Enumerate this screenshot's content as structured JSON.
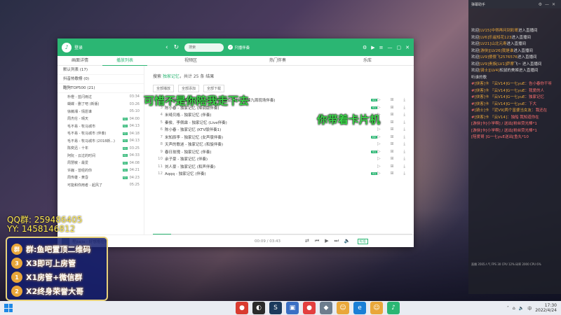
{
  "window": {
    "login": "登录",
    "search_placeholder": "搜索",
    "listen_label": "只播伴奏",
    "tabs": [
      "画面详情",
      "播放列表",
      "视频区",
      "热门伴奏",
      "乐库"
    ],
    "active_tab": 1
  },
  "sidebar": {
    "groups": [
      "默认列表 (17)",
      "抖音热歌榜 (0)",
      "酷狗TOP500 (21)"
    ],
    "songs": [
      {
        "name": "朴橙 - 蓝闪雨过",
        "dur": "03:34",
        "sq": false
      },
      {
        "name": "蝴蝶 - 删了吧 (新版)",
        "dur": "03:26",
        "sq": false
      },
      {
        "name": "徐薇湘 - 情愿谁",
        "dur": "05:10",
        "sq": false
      },
      {
        "name": "周杰伦 - 晴天",
        "dur": "04:00",
        "sq": true
      },
      {
        "name": "毛不易 - 牧马城市",
        "dur": "04:13",
        "sq": true
      },
      {
        "name": "毛不易 - 牧马城市 (伴奏)",
        "dur": "04:18",
        "sq": true
      },
      {
        "name": "毛不易 - 牧马城市 (2018新...)",
        "dur": "04:13",
        "sq": true
      },
      {
        "name": "陈奕迅 - 十年",
        "dur": "03:25",
        "sq": true
      },
      {
        "name": "阿阮 - 云过的时间",
        "dur": "04:33",
        "sq": true
      },
      {
        "name": "周慧敏 - 最爱",
        "dur": "04:08",
        "sq": true
      },
      {
        "name": "许巍 - 曾经的你",
        "dur": "04:21",
        "sq": true
      },
      {
        "name": "周传雄 - 黄昏",
        "dur": "04:23",
        "sq": true
      },
      {
        "name": "可能和你用者 - 起风了",
        "dur": "05:25",
        "sq": false
      }
    ]
  },
  "main": {
    "search_prefix": "搜索",
    "keyword": "独家记忆",
    "search_suffix": "，共计 25 条 结果",
    "actions": [
      "全部播放",
      "全部添加",
      "全部下载"
    ],
    "songs": [
      {
        "num": "2",
        "title": "那可唯 - 独家记忆 (2016新版唱闭键盘情书一辛辣九周现场伴奏)",
        "hl": true,
        "tag": "SQ"
      },
      {
        "num": "3",
        "title": "陈小春 - 独家记忆 (降调版伴奏)",
        "hl": true,
        "tag": "SQ"
      },
      {
        "num": "4",
        "title": "米绮贝格 - 独家记忆 (伴奏)",
        "hl": true,
        "tag": ""
      },
      {
        "num": "5",
        "title": "秦俊、李佩霖 - 独家记忆 (Live伴奏)",
        "hl": true,
        "tag": ""
      },
      {
        "num": "6",
        "title": "陈小春 - 独家记忆 (KTV版伴奏1)",
        "hl": true,
        "tag": ""
      },
      {
        "num": "7",
        "title": "米知辰李 - 独家记忆 (女声版伴奏)",
        "hl": true,
        "tag": "MV"
      },
      {
        "num": "8",
        "title": "天声的歌迷 - 独家记忆 (和旋伴奏)",
        "hl": true,
        "tag": ""
      },
      {
        "num": "9",
        "title": "春日玫瑰 - 独家记忆 (伴奏)",
        "hl": true,
        "tag": "SQ"
      },
      {
        "num": "10",
        "title": "余子豪 - 独家记忆 (伴奏)",
        "hl": true,
        "tag": ""
      },
      {
        "num": "11",
        "title": "刘人豪 - 独家记忆 (和声伴奏)",
        "hl": true,
        "tag": ""
      },
      {
        "num": "12",
        "title": "Aqqq - 独家记忆 (伴奏)",
        "hl": true,
        "tag": "SQ"
      }
    ]
  },
  "player": {
    "now_playing": "程jiajia - 好想抱住你",
    "time": "00:09 / 03:43",
    "quality": "标准",
    "progress": 0.07
  },
  "overlay": {
    "lyric1": "可惜不是你陪我走下去",
    "lyric2": "你带着卡片机",
    "qq": "QQ群: 259486405",
    "yy": "YY:  1458146812",
    "panel": [
      {
        "icon": "群",
        "text": "群:鱼吧置顶二维码"
      },
      {
        "icon": "3",
        "text": "X3即可上房管"
      },
      {
        "icon": "1",
        "text": "X1房管+微信群"
      },
      {
        "icon": "2",
        "text": "X2终身荣誉大哥"
      }
    ]
  },
  "chat": {
    "header": "弹幕助手",
    "messages": [
      {
        "pre": "欢迎",
        "name": "[LV15]中得再问到彩哥",
        "post": "进入直播间",
        "gift": false
      },
      {
        "pre": "欢迎",
        "name": "[LV6]乐遥知花123",
        "post": "进入直播间",
        "gift": false
      },
      {
        "pre": "欢迎",
        "name": "[LV21]山北元寿",
        "post": "进入直播间",
        "gift": false
      },
      {
        "pre": "欢迎",
        "name": "[游侠][LV26]我是谁",
        "post": "进入直播间",
        "gift": false
      },
      {
        "pre": "欢迎",
        "name": "[LV9]傻傻飞2576576",
        "post": "进入直播间",
        "gift": false
      },
      {
        "pre": "欢迎",
        "name": "[LV9]贵族[LV1]萨摩",
        "post": "飞~ 进入直播间",
        "gift": false
      },
      {
        "pre": "欢迎",
        "name": "[骑士][LV4]",
        "post": "松鼠的美姬进入直播间",
        "gift": false
      },
      {
        "pre": "",
        "name": "",
        "post": "听谁的歌",
        "gift": false
      },
      {
        "pre": "#",
        "name": "[侠客]卡 『云V14]G一七yuE",
        "post": "：告小春你干听",
        "gift": true
      },
      {
        "pre": "#",
        "name": "[侠客]卡 『云V14]G一七yuE",
        "post": "：我爱的人",
        "gift": true
      },
      {
        "pre": "#",
        "name": "[侠客]卡 『云V14]G一七yuE",
        "post": "：独家记忆",
        "gift": true
      },
      {
        "pre": "#",
        "name": "[侠客]卡 『云V14]G一七yuE",
        "post": "：下大",
        "gift": true
      },
      {
        "pre": "#",
        "name": "[骑士]卡 『泥V9]两个富婆当女友",
        "post": "：我还在",
        "gift": true
      },
      {
        "pre": "#",
        "name": "[侠客]卡 『云V14]",
        "post": "：独船 我知道你在",
        "gift": true
      },
      {
        "pre": "",
        "name": "",
        "post": "[游侠]卡[小学啊] / 送出[粉丝荧光棒*1",
        "gift": true
      },
      {
        "pre": "",
        "name": "",
        "post": "[游侠]卡[小学啊] / 送出[粉丝荧光棒*1",
        "gift": true
      },
      {
        "pre": "",
        "name": "",
        "post": "[陪爱哥 ]G一七yuE送出[鱼丸*10",
        "gift": true
      }
    ],
    "status": "直播 3565人气 FPS 30 CPU 12% 码率 2000 CPU 6%"
  },
  "taskbar": {
    "apps": [
      {
        "glyph": "●",
        "color": "#d93b30"
      },
      {
        "glyph": "◐",
        "color": "#2b2b2b"
      },
      {
        "glyph": "S",
        "color": "#1b3a5c"
      },
      {
        "glyph": "▣",
        "color": "#3a6fc4"
      },
      {
        "glyph": "●",
        "color": "#e33f3f"
      },
      {
        "glyph": "◆",
        "color": "#6d7d8d"
      },
      {
        "glyph": "☺",
        "color": "#e9a73a"
      },
      {
        "glyph": "e",
        "color": "#1a7fd6"
      },
      {
        "glyph": "☺",
        "color": "#e9a73a"
      },
      {
        "glyph": "♪",
        "color": "#2bb673"
      }
    ],
    "ime": "中",
    "time": "17:30",
    "date": "2022/4/24"
  }
}
